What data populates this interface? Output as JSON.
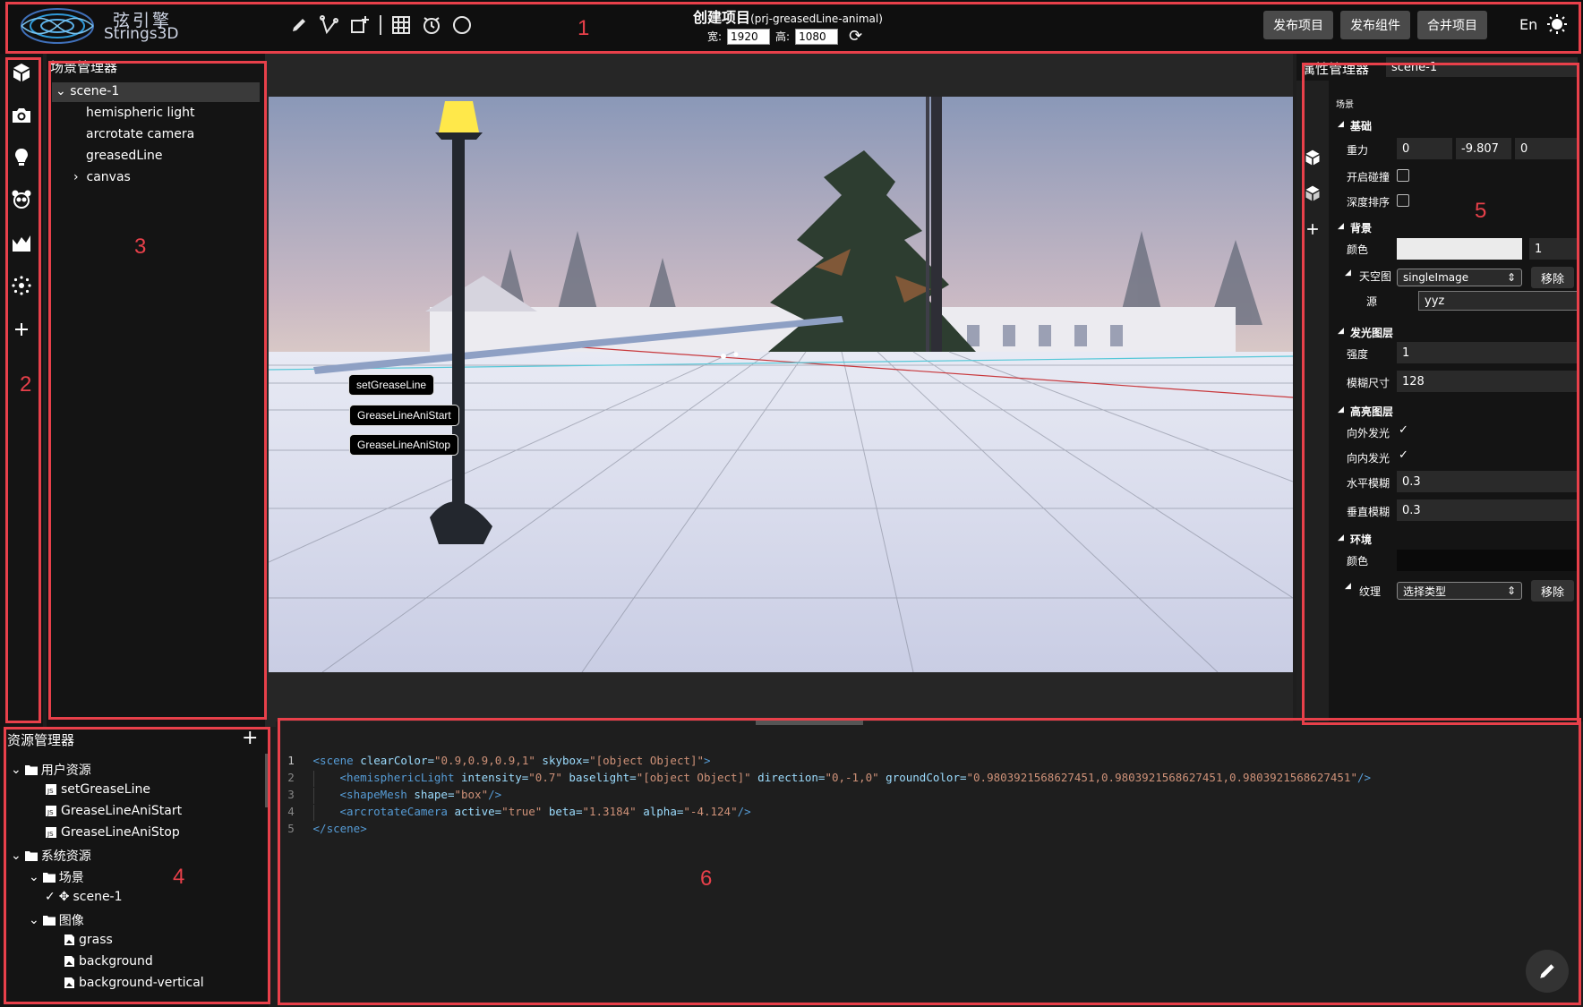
{
  "header": {
    "logo_cn": "弦引擎",
    "logo_en": "Strings3D",
    "project_title": "创建项目",
    "project_id": "(prj-greasedLine-animal)",
    "width_label": "宽:",
    "width_value": "1920",
    "height_label": "高:",
    "height_value": "1080",
    "buttons": {
      "publish_project": "发布项目",
      "publish_component": "发布组件",
      "merge_project": "合并项目"
    },
    "lang": "En",
    "tool_icons": [
      "pencil-icon",
      "node-edit-icon",
      "add-shape-icon",
      "grid-icon",
      "clock-icon",
      "circle-icon"
    ]
  },
  "annotations": [
    "1",
    "2",
    "3",
    "4",
    "5",
    "6"
  ],
  "iconbar": {
    "icons": [
      "cube-icon",
      "camera-icon",
      "light-bulb-icon",
      "panda-icon",
      "terrain-icon",
      "particles-icon",
      "plus-icon"
    ]
  },
  "scene_manager": {
    "title": "场景管理器",
    "items": [
      {
        "label": "scene-1",
        "expanded": true,
        "selected": true
      },
      {
        "label": "hemispheric light"
      },
      {
        "label": "arcrotate camera"
      },
      {
        "label": "greasedLine"
      },
      {
        "label": "canvas",
        "expanded": false
      }
    ]
  },
  "viewport": {
    "buttons": [
      "setGreaseLine",
      "GreaseLineAniStart",
      "GreaseLineAniStop"
    ]
  },
  "properties": {
    "title": "属性管理器",
    "name_value": "scene-1",
    "scene_label": "场景",
    "basic": {
      "title": "基础",
      "gravity_label": "重力",
      "gravity": [
        "0",
        "-9.807",
        "0"
      ],
      "collision_label": "开启碰撞",
      "depth_sort_label": "深度排序"
    },
    "background": {
      "title": "背景",
      "color_label": "颜色",
      "color_value": "#ebebeb",
      "alpha_value": "1",
      "skybox_label": "天空图",
      "skybox_value": "singleImage",
      "remove_label": "移除",
      "source_label": "源",
      "source_value": "yyz"
    },
    "glow": {
      "title": "发光图层",
      "intensity_label": "强度",
      "intensity_value": "1",
      "blur_label": "模糊尺寸",
      "blur_value": "128"
    },
    "highlight": {
      "title": "高亮图层",
      "outer_label": "向外发光",
      "inner_label": "向内发光",
      "hblur_label": "水平模糊",
      "hblur_value": "0.3",
      "vblur_label": "垂直模糊",
      "vblur_value": "0.3"
    },
    "environment": {
      "title": "环境",
      "color_label": "颜色",
      "texture_label": "纹理",
      "texture_value": "选择类型",
      "remove_label": "移除"
    }
  },
  "resources": {
    "title": "资源管理器",
    "items": [
      {
        "label": "用户资源",
        "type": "folder"
      },
      {
        "label": "setGreaseLine",
        "type": "script"
      },
      {
        "label": "GreaseLineAniStart",
        "type": "script"
      },
      {
        "label": "GreaseLineAniStop",
        "type": "script"
      },
      {
        "label": "系统资源",
        "type": "folder"
      },
      {
        "label": "场景",
        "type": "folder"
      },
      {
        "label": "scene-1",
        "type": "scene"
      },
      {
        "label": "图像",
        "type": "folder"
      },
      {
        "label": "grass",
        "type": "image"
      },
      {
        "label": "background",
        "type": "image"
      },
      {
        "label": "background-vertical",
        "type": "image"
      }
    ]
  },
  "editor": {
    "line_numbers": [
      "1",
      "2",
      "3",
      "4",
      "5"
    ],
    "l1": {
      "tag": "<scene",
      "a1": " clearColor=",
      "v1": "\"0.9,0.9,0.9,1\"",
      "a2": " skybox=",
      "v2": "\"[object Object]\"",
      "end": ">"
    },
    "l2": {
      "tag": "<hemisphericLight",
      "a1": " intensity=",
      "v1": "\"0.7\"",
      "a2": " baselight=",
      "v2": "\"[object Object]\"",
      "a3": " direction=",
      "v3": "\"0,-1,0\"",
      "a4": " groundColor=",
      "v4": "\"0.9803921568627451,0.9803921568627451,0.9803921568627451\"",
      "end": "/>"
    },
    "l3": {
      "tag": "<shapeMesh",
      "a1": " shape=",
      "v1": "\"box\"",
      "end": "/>"
    },
    "l4": {
      "tag": "<arcrotateCamera",
      "a1": " active=",
      "v1": "\"true\"",
      "a2": " beta=",
      "v2": "\"1.3184\"",
      "a3": " alpha=",
      "v3": "\"-4.124\"",
      "end": "/>"
    },
    "l5": {
      "tag": "</scene",
      "end": ">"
    }
  }
}
